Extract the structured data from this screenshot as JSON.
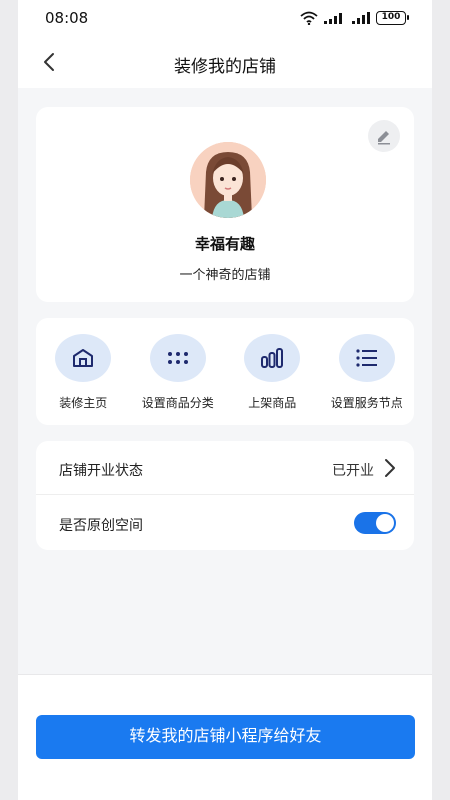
{
  "status_bar": {
    "time": "08:08",
    "battery": "100"
  },
  "nav": {
    "title": "装修我的店铺",
    "back_icon": "chevron-left-icon"
  },
  "profile": {
    "shop_name": "幸福有趣",
    "description": "一个神奇的店铺",
    "edit_icon": "pencil-icon",
    "avatar_icon": "avatar-girl-illustration"
  },
  "actions": [
    {
      "label": "装修主页",
      "icon": "home-icon"
    },
    {
      "label": "设置商品分类",
      "icon": "grid-dots-icon"
    },
    {
      "label": "上架商品",
      "icon": "bar-chart-icon"
    },
    {
      "label": "设置服务节点",
      "icon": "list-icon"
    }
  ],
  "settings": {
    "open_status_label": "店铺开业状态",
    "open_status_value": "已开业",
    "original_label": "是否原创空间",
    "original_enabled": true
  },
  "bottom": {
    "share_label": "转发我的店铺小程序给好友"
  },
  "colors": {
    "accent": "#1a7af0",
    "icon_bg": "#dde8f8",
    "icon_fg": "#1e2a6e",
    "page_bg": "#f5f6f8"
  }
}
